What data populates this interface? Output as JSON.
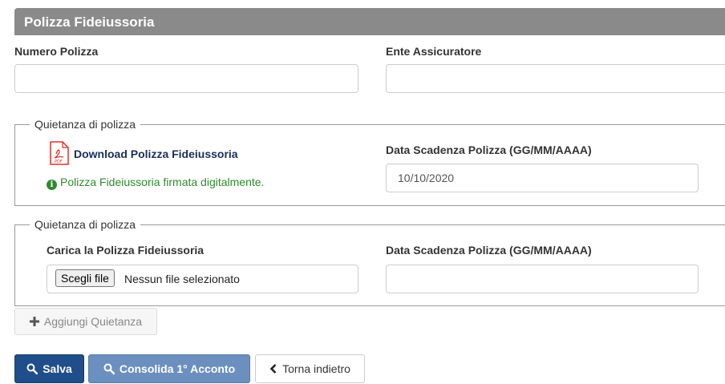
{
  "panel": {
    "title": "Polizza Fideiussoria"
  },
  "fields": {
    "numero_polizza": {
      "label": "Numero Polizza",
      "value": ""
    },
    "ente_assicuratore": {
      "label": "Ente Assicuratore",
      "value": ""
    }
  },
  "quietanze": [
    {
      "legend": "Quietanza di polizza",
      "download_label": "Download Polizza Fideiussoria",
      "signed_message": "Polizza Fideiussoria firmata digitalmente.",
      "scadenza_label": "Data Scadenza Polizza (GG/MM/AAAA)",
      "scadenza_value": "10/10/2020"
    },
    {
      "legend": "Quietanza di polizza",
      "upload_label": "Carica la Polizza Fideiussoria",
      "file_button": "Scegli file",
      "file_status": "Nessun file selezionato",
      "scadenza_label": "Data Scadenza Polizza (GG/MM/AAAA)",
      "scadenza_value": ""
    }
  ],
  "buttons": {
    "add": "Aggiungi Quietanza",
    "save": "Salva",
    "consolida": "Consolida 1° Acconto",
    "back": "Torna indietro"
  },
  "icons": {
    "pdf": "pdf-icon",
    "info": "info-icon",
    "plus": "plus-icon",
    "search": "search-icon",
    "back": "chevron-left-icon"
  },
  "colors": {
    "header_bg": "#8a8a8a",
    "primary": "#1f4e8a",
    "primary_disabled": "#6b8fbf",
    "success": "#2e8b2e",
    "link": "#1a2e5a"
  }
}
